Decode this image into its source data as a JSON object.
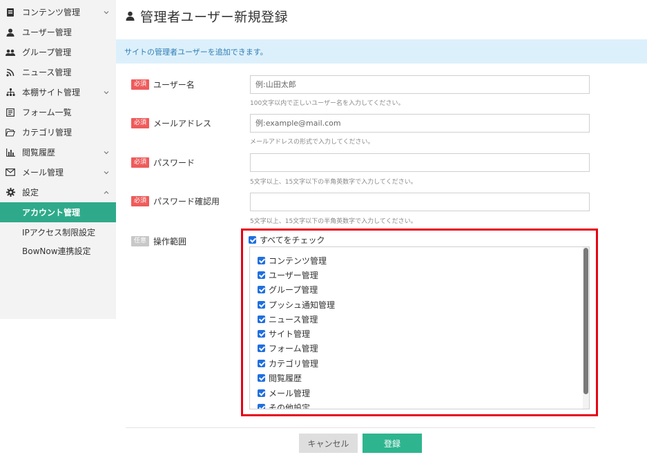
{
  "sidebar": {
    "items": [
      {
        "label": "コンテンツ管理",
        "icon": "content-icon",
        "chevron": "down"
      },
      {
        "label": "ユーザー管理",
        "icon": "user-icon",
        "chevron": ""
      },
      {
        "label": "グループ管理",
        "icon": "group-icon",
        "chevron": ""
      },
      {
        "label": "ニュース管理",
        "icon": "rss-icon",
        "chevron": ""
      },
      {
        "label": "本棚サイト管理",
        "icon": "sitemap-icon",
        "chevron": "down"
      },
      {
        "label": "フォーム一覧",
        "icon": "form-icon",
        "chevron": ""
      },
      {
        "label": "カテゴリ管理",
        "icon": "folder-icon",
        "chevron": ""
      },
      {
        "label": "閲覧履歴",
        "icon": "chart-icon",
        "chevron": "down"
      },
      {
        "label": "メール管理",
        "icon": "mail-icon",
        "chevron": "down"
      },
      {
        "label": "設定",
        "icon": "gear-icon",
        "chevron": "up"
      }
    ],
    "sub_items": [
      {
        "label": "アカウント管理",
        "active": true
      },
      {
        "label": "IPアクセス制限設定",
        "active": false
      },
      {
        "label": "BowNow連携設定",
        "active": false
      }
    ]
  },
  "page": {
    "title": "管理者ユーザー新規登録",
    "info": "サイトの管理者ユーザーを追加できます。"
  },
  "form": {
    "required_badge": "必須",
    "optional_badge": "任意",
    "username": {
      "label": "ユーザー名",
      "placeholder": "例:山田太郎",
      "help": "100文字以内で正しいユーザー名を入力してください。"
    },
    "email": {
      "label": "メールアドレス",
      "placeholder": "例:example@mail.com",
      "help": "メールアドレスの形式で入力してください。"
    },
    "password": {
      "label": "パスワード",
      "placeholder": "",
      "help": "5文字以上、15文字以下の半角英数字で入力してください。"
    },
    "password_confirm": {
      "label": "パスワード確認用",
      "placeholder": "",
      "help": "5文字以上、15文字以下の半角英数字で入力してください。"
    },
    "scope": {
      "label": "操作範囲",
      "check_all": "すべてをチェック",
      "items": [
        "コンテンツ管理",
        "ユーザー管理",
        "グループ管理",
        "プッシュ通知管理",
        "ニュース管理",
        "サイト管理",
        "フォーム管理",
        "カテゴリ管理",
        "閲覧履歴",
        "メール管理",
        "その他設定"
      ]
    }
  },
  "buttons": {
    "cancel": "キャンセル",
    "save": "登録"
  },
  "colors": {
    "accent": "#2eaa8a",
    "required": "#ef5b5b",
    "highlight": "#e60012",
    "checkbox": "#1f6fe0"
  }
}
